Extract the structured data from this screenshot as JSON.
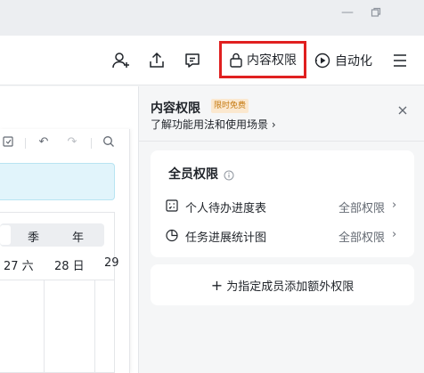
{
  "window": {
    "minimize_icon": "minimize-icon",
    "restore_icon": "restore-icon"
  },
  "header": {
    "permission_label": "内容权限",
    "automation_label": "自动化",
    "icons": [
      "add-member-icon",
      "share-upload-icon",
      "comment-icon",
      "lock-icon",
      "automation-icon",
      "menu-icon"
    ],
    "highlight_color": "#e02020"
  },
  "background_doc": {
    "segments": [
      "季",
      "年"
    ],
    "days": [
      "27 六",
      "28 日",
      "29"
    ]
  },
  "panel": {
    "title": "内容权限",
    "badge": "限时免费",
    "subtitle": "了解功能用法和使用场景 ›",
    "card": {
      "title": "全员权限",
      "rows": [
        {
          "icon": "todo-table-icon",
          "name": "个人待办进度表",
          "permission": "全部权限"
        },
        {
          "icon": "pie-chart-icon",
          "name": "任务进展统计图",
          "permission": "全部权限"
        }
      ]
    },
    "add_label": "为指定成员添加额外权限"
  }
}
